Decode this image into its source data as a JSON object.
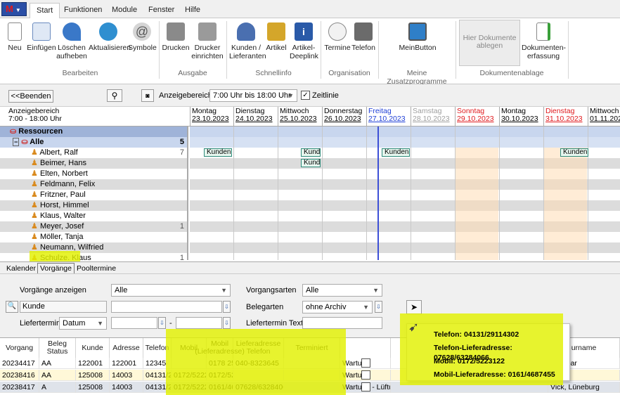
{
  "menu": {
    "app_button": "M",
    "tabs": [
      "Start",
      "Funktionen",
      "Module",
      "Fenster",
      "Hilfe"
    ]
  },
  "ribbon": {
    "buttons": [
      {
        "label": "Neu",
        "icon": "new-doc-icon"
      },
      {
        "label": "Einfügen",
        "icon": "insert-grid-icon"
      },
      {
        "label": "Löschen aufheben",
        "icon": "undo-arrow-icon"
      },
      {
        "label": "Aktualisieren",
        "icon": "refresh-icon"
      },
      {
        "label": "Symbole",
        "icon": "at-sign-icon"
      },
      {
        "label": "Drucken",
        "icon": "printer-icon"
      },
      {
        "label": "Drucker einrichten",
        "icon": "printer-setup-icon"
      },
      {
        "label": "Kunden / Lieferanten",
        "icon": "people-icon"
      },
      {
        "label": "Artikel",
        "icon": "box-icon"
      },
      {
        "label": "Artikel-Deeplink",
        "icon": "info-icon"
      },
      {
        "label": "Termine",
        "icon": "clock-icon"
      },
      {
        "label": "Telefon",
        "icon": "phone-icon"
      },
      {
        "label": "MeinButton",
        "icon": "monitor-icon"
      },
      {
        "label": "Hier Dokumente ablegen",
        "icon": ""
      },
      {
        "label": "Dokumenten-erfassung",
        "icon": "doc-scan-icon"
      }
    ],
    "groups": [
      "Bearbeiten",
      "Ausgabe",
      "Schnellinfo",
      "Organisation",
      "Meine Zusatzprogramme",
      "Dokumentenablage"
    ]
  },
  "toolbar": {
    "back_label": "<<Beenden",
    "range_label": "Anzeigebereich:",
    "range_value": "7:00 Uhr bis 18:00 Uhr",
    "timeline_label": "Zeitlinie",
    "timeline_checked": true
  },
  "calendar": {
    "range_title": "Anzeigebereich",
    "range_time": "7:00 - 18:00 Uhr",
    "days": [
      {
        "name": "Montag",
        "date": "23.10.2023",
        "color": "#000000"
      },
      {
        "name": "Dienstag",
        "date": "24.10.2023",
        "color": "#000000"
      },
      {
        "name": "Mittwoch",
        "date": "25.10.2023",
        "color": "#000000"
      },
      {
        "name": "Donnerstag",
        "date": "26.10.2023",
        "color": "#000000"
      },
      {
        "name": "Freitag",
        "date": "27.10.2023",
        "color": "#1f3fd6"
      },
      {
        "name": "Samstag",
        "date": "28.10.2023",
        "color": "#a0a0a0"
      },
      {
        "name": "Sonntag",
        "date": "29.10.2023",
        "color": "#e0191d"
      },
      {
        "name": "Montag",
        "date": "30.10.2023",
        "color": "#000000"
      },
      {
        "name": "Dienstag",
        "date": "31.10.2023",
        "color": "#e0191d"
      },
      {
        "name": "Mittwoch",
        "date": "01.11.202",
        "color": "#000000"
      }
    ],
    "resources_header": "Ressourcen",
    "group_label": "Alle",
    "group_count": "5",
    "people": [
      {
        "name": "Albert, Ralf",
        "count": "7"
      },
      {
        "name": "Beimer, Hans",
        "count": ""
      },
      {
        "name": "Elten, Norbert",
        "count": ""
      },
      {
        "name": "Feldmann, Felix",
        "count": ""
      },
      {
        "name": "Fritzner, Paul",
        "count": ""
      },
      {
        "name": "Horst, Himmel",
        "count": ""
      },
      {
        "name": "Klaus, Walter",
        "count": ""
      },
      {
        "name": "Meyer, Josef",
        "count": "1"
      },
      {
        "name": "Möller, Tanja",
        "count": ""
      },
      {
        "name": "Neumann, Wilfried",
        "count": ""
      },
      {
        "name": "Schulze, Klaus",
        "count": "1"
      }
    ],
    "chips": {
      "kunden": "Kunden",
      "kund": "Kund"
    }
  },
  "bottom_tabs": [
    "Kalender",
    "Vorgänge",
    "Pooltermine"
  ],
  "filters": {
    "vorgaenge_label": "Vorgänge anzeigen",
    "vorgaenge_value": "Alle",
    "vorgangsarten_label": "Vorgangsarten",
    "vorgangsarten_value": "Alle",
    "kunde_label": "Kunde",
    "belegarten_label": "Belegarten",
    "belegarten_value": "ohne Archiv",
    "liefertermin_label": "Liefertermin",
    "liefertermin_value": "Datum",
    "liefertermin_sep": "-",
    "liefertermin_text_label": "Liefertermin Text"
  },
  "table": {
    "headers": [
      "Vorgang",
      "Beleg Status",
      "Kunde",
      "Adresse",
      "Telefon",
      "Mobil",
      "Mobil (Lieferadresse)",
      "Lieferadresse Telefon",
      "Terminiert",
      "",
      "",
      "urname"
    ],
    "rows": [
      [
        "20234417",
        "AA",
        "122001",
        "122001",
        "12345",
        "",
        "0178 2545566",
        "040-8323645",
        "",
        "Wartu",
        "",
        "e, Urbar"
      ],
      [
        "20238416",
        "AA",
        "125008",
        "14003",
        "04131/29",
        "0172/5222",
        "0172/5223122",
        "",
        "",
        "Wartu",
        "",
        "eburg"
      ],
      [
        "20238417",
        "A",
        "125008",
        "14003",
        "04131/29",
        "0172/5222",
        "0161/4687455",
        "07628/63284066",
        "",
        "Wartung - Lüftungsanlage ZX123",
        "",
        "Vick, Lüneburg"
      ]
    ]
  },
  "popup": {
    "lines": [
      "Telefon: 04131/29114302",
      "Telefon-Lieferadresse: 07628/63284066",
      "Mobil: 0172/5223122",
      "Mobil-Lieferadresse: 0161/4687455"
    ]
  }
}
